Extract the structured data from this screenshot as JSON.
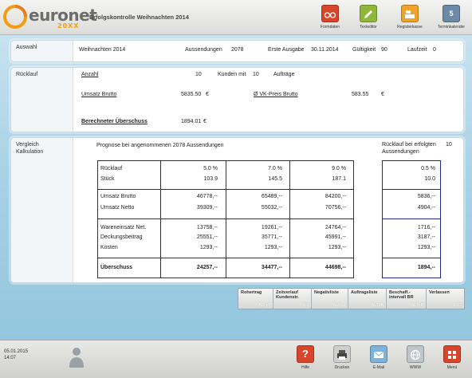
{
  "header": {
    "brand": "euronet",
    "brand_sub": "20XX",
    "title": "Erfolgskontrolle Weihnachten 2014",
    "buttons": [
      {
        "label": "Formdaten",
        "icon": "glasses-icon"
      },
      {
        "label": "Texteditor",
        "icon": "pencil-icon"
      },
      {
        "label": "Registerkasse",
        "icon": "cash-register-icon"
      },
      {
        "label": "Terminkalender",
        "icon": "calendar-icon"
      }
    ],
    "calendar_day": "5"
  },
  "auswahl": {
    "label": "Auswahl",
    "name": "Weihnachten 2014",
    "aussendungen_label": "Aussendungen",
    "aussendungen_value": "2078",
    "erste_ausgabe_label": "Erste Ausgabe",
    "erste_ausgabe_value": "30.11.2014",
    "gueltigkeit_label": "Gültigkeit",
    "gueltigkeit_value": "90",
    "laufzeit_label": "Laufzeit",
    "laufzeit_value": "0"
  },
  "ruecklauf": {
    "label": "Rücklauf",
    "anzahl_label": "Anzahl",
    "anzahl_value": "10",
    "kunden_mit_label": "Kunden mit",
    "kunden_mit_value": "10",
    "auftraege_label": "Aufträge",
    "umsatz_label": "Umsatz Brutto",
    "umsatz_value": "5835.50",
    "umsatz_currency": "€",
    "vk_label": "Ø VK-Preis Brutto",
    "vk_value": "583.55",
    "vk_currency": "€",
    "ueberschuss_label": "Berechneter Überschuss",
    "ueberschuss_value": "1894.01",
    "ueberschuss_currency": "€"
  },
  "vergleich": {
    "label_line1": "Vergleich",
    "label_line2": "Kalkulation",
    "prognose_title": "Prognose bei angenommenen  2078 Aussendungen",
    "rueck_title_line1": "Rücklauf bei erfolgten",
    "rueck_title_line2": "Aussendungen",
    "rueck_count": "10",
    "row_labels": {
      "ruecklauf": "Rücklauf",
      "stueck": "Stück",
      "umsatz_brutto": "Umsatz Brutto",
      "umsatz_netto": "Umsatz Netto",
      "wareneinsatz": "Wareneinsatz Net.",
      "deckungsbeitrag": "Deckungsbeitrag",
      "kosten": "Kosten",
      "ueberschuss": "Überschuss"
    },
    "columns": [
      {
        "ruecklauf": "5.0 %",
        "stueck": "103.9",
        "umsatz_brutto": "46778,--",
        "umsatz_netto": "39309,--",
        "wareneinsatz": "13758,--",
        "deckungsbeitrag": "25551,--",
        "kosten": "1293,--",
        "ueberschuss": "24257,--"
      },
      {
        "ruecklauf": "7.0 %",
        "stueck": "145.5",
        "umsatz_brutto": "65489,--",
        "umsatz_netto": "55032,--",
        "wareneinsatz": "19261,--",
        "deckungsbeitrag": "35771,--",
        "kosten": "1293,--",
        "ueberschuss": "34477,--"
      },
      {
        "ruecklauf": "9.0 %",
        "stueck": "187.1",
        "umsatz_brutto": "84200,--",
        "umsatz_netto": "70756,--",
        "wareneinsatz": "24764,--",
        "deckungsbeitrag": "45991,--",
        "kosten": "1293,--",
        "ueberschuss": "44698,--"
      }
    ],
    "actual": {
      "ruecklauf": "0.5 %",
      "stueck": "10.0",
      "umsatz_brutto": "5836,--",
      "umsatz_netto": "4904,--",
      "wareneinsatz": "1716,--",
      "deckungsbeitrag": "3187,--",
      "kosten": "1293,--",
      "ueberschuss": "1894,--"
    }
  },
  "function_buttons": [
    {
      "label": "Rohertrag",
      "key": "ALT+T"
    },
    {
      "label": "Zeitverlauf Kundenstr.",
      "key": "F3"
    },
    {
      "label": "Negativliste",
      "key": "ALT+N"
    },
    {
      "label": "Auftragsliste",
      "key": "ALT+A"
    },
    {
      "label": "Beschaff.-intervall BR",
      "key": "ALT+B"
    },
    {
      "label": "Verlassen",
      "key": "ESC"
    }
  ],
  "footer": {
    "date": "05.01.2015",
    "time": "14:07",
    "buttons": [
      {
        "label": "Hilfe",
        "icon": "help-icon",
        "glyph": "?"
      },
      {
        "label": "Drucken",
        "icon": "printer-icon"
      },
      {
        "label": "E-Mail",
        "icon": "mail-icon"
      },
      {
        "label": "WWW",
        "icon": "globe-icon"
      },
      {
        "label": "Menü",
        "icon": "menu-grid-icon"
      }
    ]
  }
}
